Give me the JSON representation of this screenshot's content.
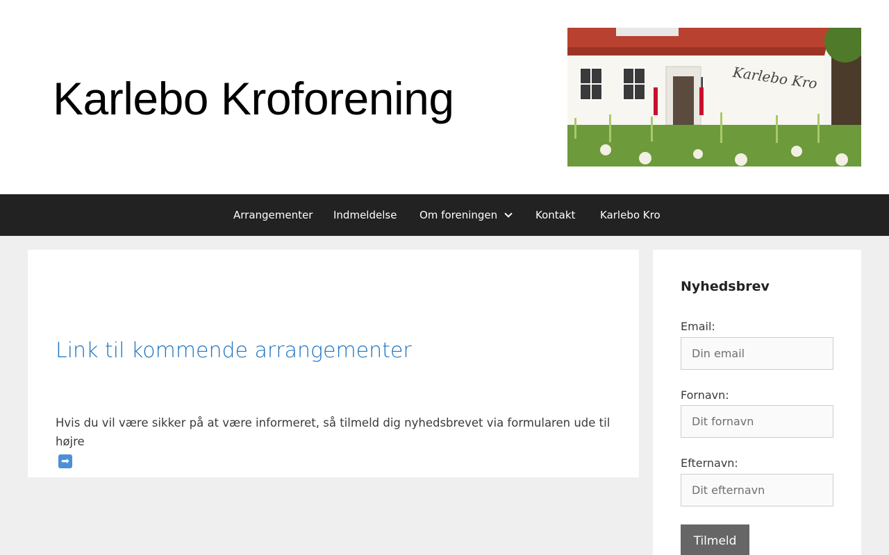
{
  "header": {
    "site_title": "Karlebo Kroforening",
    "image_sign_text": "Karlebo Kro"
  },
  "nav": {
    "items": [
      {
        "label": "Arrangementer"
      },
      {
        "label": "Indmeldelse"
      },
      {
        "label": "Om foreningen",
        "has_dropdown": true
      },
      {
        "label": "Kontakt"
      },
      {
        "label": "Karlebo Kro"
      }
    ]
  },
  "content": {
    "entry_title": "Link til kommende arrangementer",
    "entry_text": "Hvis du vil være sikker på at være informeret, så tilmeld dig nyhedsbrevet via formularen ude til højre",
    "arrow_icon": "right-arrow-emoji"
  },
  "sidebar": {
    "widget_title": "Nyhedsbrev",
    "email_label": "Email:",
    "email_placeholder": "Din email",
    "firstname_label": "Fornavn:",
    "firstname_placeholder": "Dit fornavn",
    "lastname_label": "Efternavn:",
    "lastname_placeholder": "Dit efternavn",
    "submit_label": "Tilmeld"
  },
  "colors": {
    "nav_bg": "#222222",
    "link": "#1e73be",
    "page_bg": "#efefef",
    "button_bg": "#666666"
  }
}
